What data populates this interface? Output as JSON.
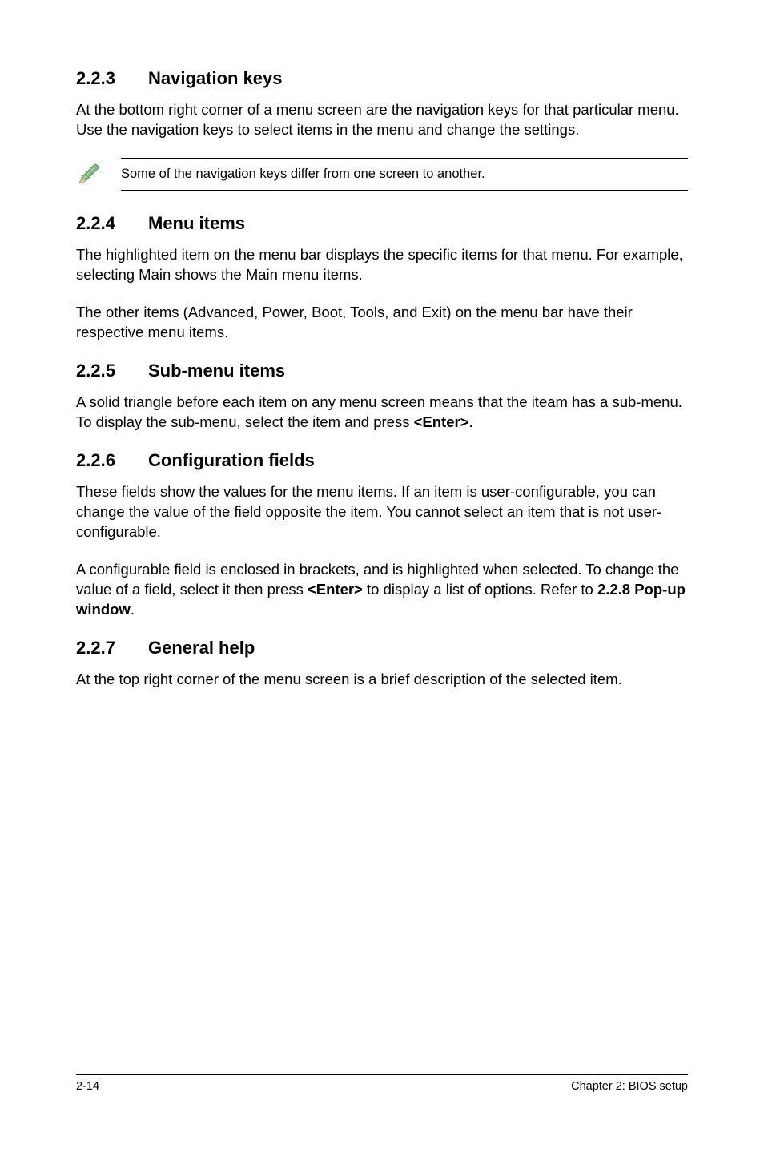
{
  "s223": {
    "num": "2.2.3",
    "title": "Navigation keys",
    "p1": "At the bottom right corner of a menu screen are the navigation keys for that particular menu. Use the navigation keys to select items in the menu and change the settings.",
    "note": "Some of the navigation keys differ from one screen to another."
  },
  "s224": {
    "num": "2.2.4",
    "title": "Menu items",
    "p1": "The highlighted item on the menu bar  displays the specific items for that menu. For example, selecting Main shows the Main menu items.",
    "p2": "The other items (Advanced, Power, Boot, Tools, and Exit) on the menu bar have their respective menu items."
  },
  "s225": {
    "num": "2.2.5",
    "title": "Sub-menu items",
    "p1_a": "A solid triangle before each item on any menu screen means that the iteam has a sub-menu. To display the sub-menu, select the item and press ",
    "p1_b": "<Enter>",
    "p1_c": "."
  },
  "s226": {
    "num": "2.2.6",
    "title": "Configuration fields",
    "p1": "These fields show the values for the menu items. If an item is user-configurable, you can change the value of the field opposite the item. You cannot select an item that is not user-configurable.",
    "p2_a": "A configurable field is enclosed in brackets, and is highlighted when selected. To change the value of a field, select it then press ",
    "p2_b": "<Enter>",
    "p2_c": " to display a list of options. Refer to ",
    "p2_d": "2.2.8 Pop-up window",
    "p2_e": "."
  },
  "s227": {
    "num": "2.2.7",
    "title": "General help",
    "p1": "At the top right corner of the menu screen is a brief description of the selected item."
  },
  "footer": {
    "page": "2-14",
    "chapter": "Chapter 2: BIOS setup"
  }
}
